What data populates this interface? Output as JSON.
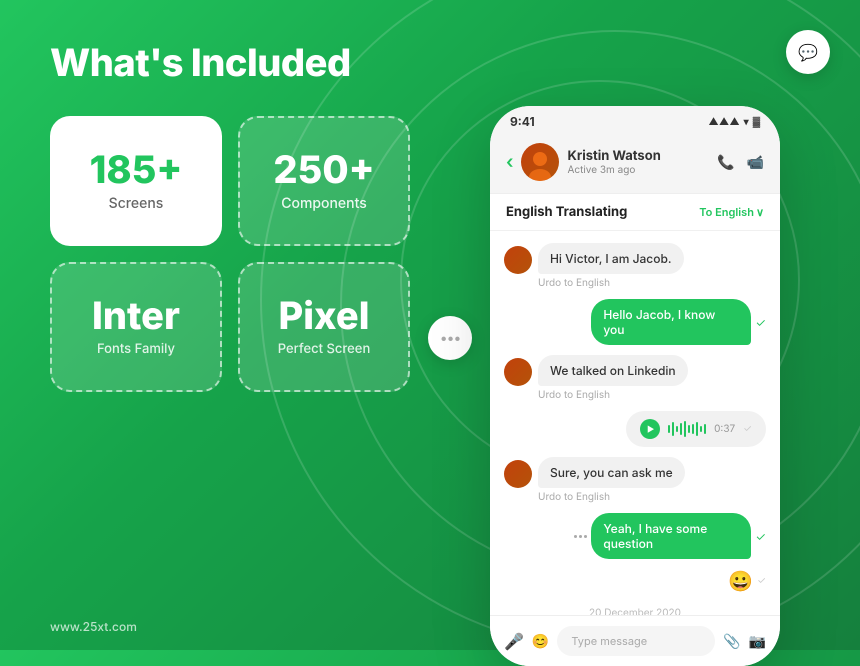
{
  "page": {
    "title": "What's Included",
    "watermark": "www.25xt.com",
    "bg_color_start": "#22c55e",
    "bg_color_end": "#15803d"
  },
  "cards": [
    {
      "id": "screens",
      "number": "185+",
      "label": "Screens",
      "style": "white"
    },
    {
      "id": "components",
      "number": "250+",
      "label": "Components",
      "style": "dashed"
    },
    {
      "id": "inter",
      "number": "Inter",
      "label": "Fonts Family",
      "style": "dashed"
    },
    {
      "id": "pixel",
      "number": "Pixel",
      "label": "Perfect Screen",
      "style": "dashed"
    }
  ],
  "phone": {
    "status_time": "9:41",
    "contact_name": "Kristin Watson",
    "contact_status": "Active 3m ago",
    "translation_label": "English Translating",
    "translation_target": "To English",
    "messages": [
      {
        "id": 1,
        "type": "received",
        "text": "Hi Victor, I am Jacob.",
        "note": "Urdo to English"
      },
      {
        "id": 2,
        "type": "sent",
        "text": "Hello Jacob, I know you"
      },
      {
        "id": 3,
        "type": "received",
        "text": "We talked on Linkedin",
        "note": "Urdo to English"
      },
      {
        "id": 4,
        "type": "audio",
        "time": "0:37"
      },
      {
        "id": 5,
        "type": "received",
        "text": "Sure, you can ask me",
        "note": "Urdo to English"
      },
      {
        "id": 6,
        "type": "sent_with_dots",
        "text": "Yeah, I have some question"
      },
      {
        "id": 7,
        "type": "emoji",
        "text": "😀"
      },
      {
        "id": 8,
        "type": "date",
        "text": "20 December 2020"
      }
    ],
    "input_placeholder": "Type message"
  },
  "icons": {
    "chat_dots": "•••",
    "back": "‹",
    "chevron_down": "⌄"
  }
}
